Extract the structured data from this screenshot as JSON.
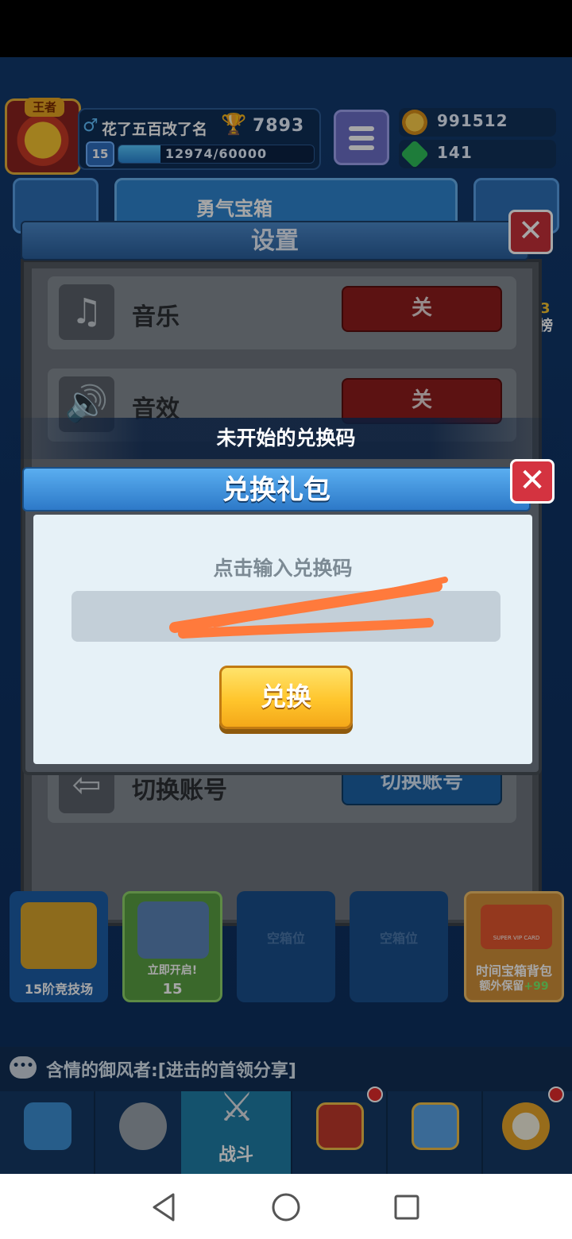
{
  "player": {
    "name": "花了五百改了名",
    "trophies": "7893",
    "level": "15",
    "xp_text": "12974/60000",
    "xp_fraction": 0.216,
    "title_badge": "王者"
  },
  "currency": {
    "gold": "991512",
    "gems": "141"
  },
  "top_row": {
    "courage_chest": "勇气宝箱"
  },
  "settings": {
    "title": "设置",
    "rows": [
      {
        "label": "音乐",
        "button": "关"
      },
      {
        "label": "音效",
        "button": "关"
      },
      {
        "label": "切换账号",
        "button": "切换账号"
      }
    ]
  },
  "redeem": {
    "caption": "未开始的兑换码",
    "title": "兑换礼包",
    "hint": "点击输入兑换码",
    "code_value": "",
    "button": "兑换"
  },
  "slots": {
    "arena": "15阶竞技场",
    "open_now": "立即开启!",
    "open_cost": "15",
    "empty1": "空箱位",
    "empty2": "空箱位",
    "time_chest": "时间宝箱背包",
    "extra_keep": "额外保留",
    "extra_keep_value": "+99",
    "vip_card": "SUPER VIP CARD"
  },
  "chat": {
    "message": "含情的御风者:[进击的首领分享]"
  },
  "nav": {
    "battle": "战斗"
  },
  "side": {
    "ranking": "榜",
    "ranking_num": "3"
  },
  "colors": {
    "accent_blue": "#2d79c8",
    "close_red": "#d43340",
    "button_yellow": "#ffc52c",
    "off_red": "#8e1d1d"
  }
}
